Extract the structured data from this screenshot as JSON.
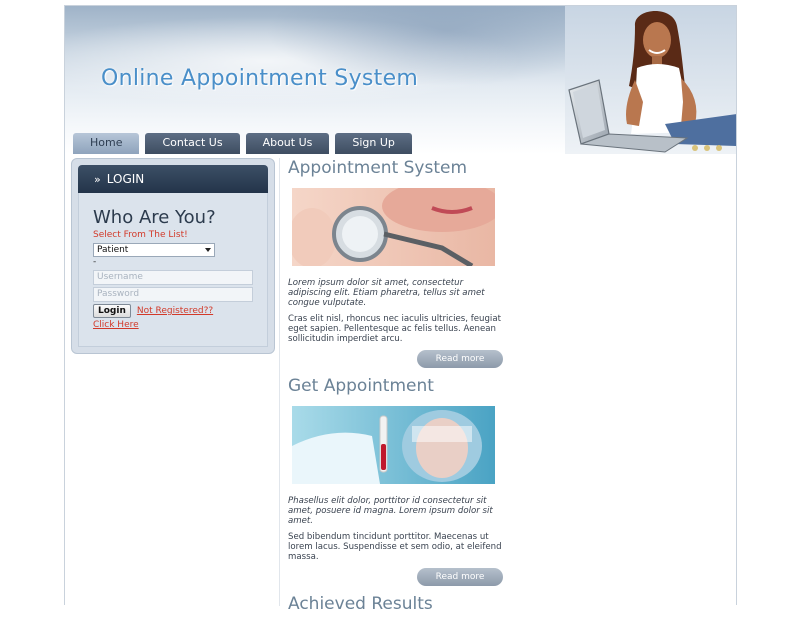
{
  "header": {
    "site_title": "Online Appointment System"
  },
  "nav": {
    "tabs": [
      {
        "label": "Home",
        "active": true
      },
      {
        "label": "Contact Us",
        "active": false
      },
      {
        "label": "About Us",
        "active": false
      },
      {
        "label": "Sign Up",
        "active": false
      }
    ]
  },
  "login": {
    "header_label": "LOGIN",
    "title": "Who Are You?",
    "select_hint": "Select From The List!",
    "role_selected": "Patient",
    "status_dot": "-",
    "username_placeholder": "Username",
    "password_placeholder": "Password",
    "login_button": "Login",
    "not_registered_link": "Not Registered??",
    "click_here_link": "Click Here"
  },
  "sections": [
    {
      "title": "Appointment System",
      "image": "stethoscope-photo",
      "intro": "Lorem ipsum dolor sit amet, consectetur adipiscing elit. Etiam pharetra, tellus sit amet congue vulputate.",
      "body": "Cras elit nisl, rhoncus nec iaculis ultricies, feugiat eget sapien. Pellentesque ac felis tellus. Aenean sollicitudin imperdiet arcu.",
      "read_more": "Read more"
    },
    {
      "title": "Get Appointment",
      "image": "lab-scientist-photo",
      "intro": "Phasellus elit dolor, porttitor id consectetur sit amet, posuere id magna. Lorem ipsum dolor sit amet.",
      "body": "Sed bibendum tincidunt porttitor. Maecenas ut lorem lacus. Suspendisse et sem odio, at eleifend massa.",
      "read_more": "Read more"
    },
    {
      "title": "Achieved Results"
    }
  ],
  "colors": {
    "title_blue": "#4a8fc9",
    "nav_dark": "#3e4d61",
    "link_red": "#d23a2a",
    "section_title": "#6b8296"
  }
}
